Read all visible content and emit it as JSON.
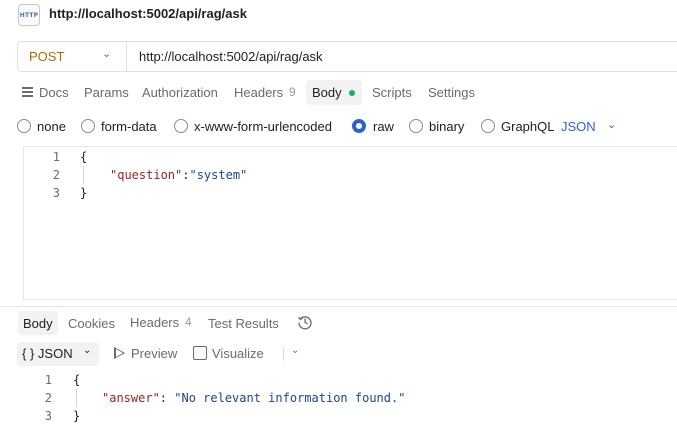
{
  "request": {
    "icon_text": "HTTP",
    "title": "http://localhost:5002/api/rag/ask",
    "method": "POST",
    "url": "http://localhost:5002/api/rag/ask"
  },
  "request_tabs": {
    "docs": "Docs",
    "params": "Params",
    "authorization": "Authorization",
    "headers": "Headers",
    "headers_count": "9",
    "body": "Body",
    "scripts": "Scripts",
    "settings": "Settings"
  },
  "body_types": {
    "none": "none",
    "form_data": "form-data",
    "urlencoded": "x-www-form-urlencoded",
    "raw": "raw",
    "binary": "binary",
    "graphql": "GraphQL",
    "selected": "raw",
    "format": "JSON"
  },
  "request_body": {
    "line_numbers": [
      "1",
      "2",
      "3"
    ],
    "open_brace": "{",
    "key": "\"question\"",
    "colon": ":",
    "value": "\"system\"",
    "close_brace": "}"
  },
  "response_tabs": {
    "body": "Body",
    "cookies": "Cookies",
    "headers": "Headers",
    "headers_count": "4",
    "test_results": "Test Results"
  },
  "response_toolbar": {
    "format": "{ } JSON",
    "preview": "Preview",
    "visualize": "Visualize"
  },
  "response_body": {
    "line_numbers": [
      "1",
      "2",
      "3"
    ],
    "open_brace": "{",
    "key": "\"answer\"",
    "colon": ": ",
    "value": "\"No relevant information found.\"",
    "close_brace": "}"
  },
  "colors": {
    "method": "#a46f04",
    "accent": "#2b61d1",
    "dot": "#0cbb52",
    "json_key": "#9f2121",
    "json_string": "#1b4594"
  }
}
